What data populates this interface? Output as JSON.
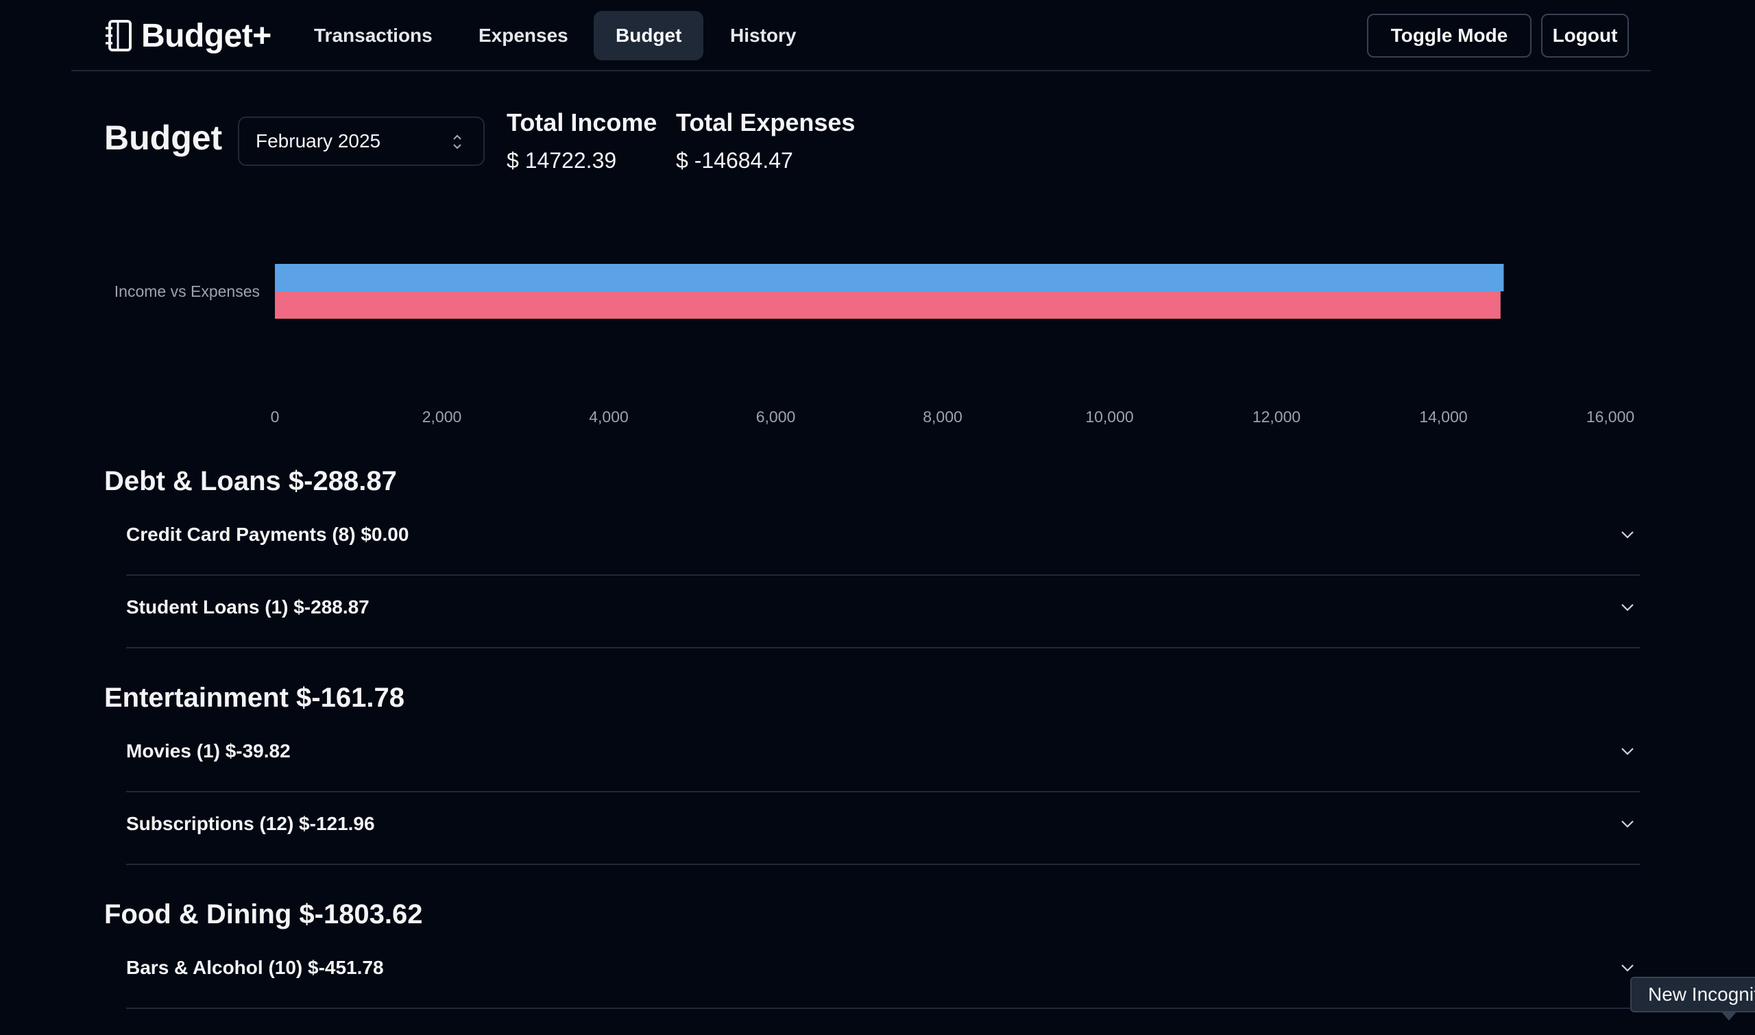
{
  "app": {
    "brand": "Budget+",
    "brand_icon": "notebook-icon"
  },
  "nav": {
    "links": [
      "Transactions",
      "Expenses",
      "Budget",
      "History"
    ],
    "active": "Budget",
    "toggle_mode": "Toggle Mode",
    "logout": "Logout"
  },
  "header": {
    "title": "Budget",
    "month": "February 2025",
    "total_income_label": "Total Income",
    "total_income_value": "$ 14722.39",
    "total_expenses_label": "Total Expenses",
    "total_expenses_value": "$ -14684.47"
  },
  "chart_data": {
    "type": "bar",
    "orientation": "horizontal",
    "categories": [
      "Income vs Expenses"
    ],
    "series": [
      {
        "values": [
          14722.39
        ],
        "color": "#5ba3e6"
      },
      {
        "values": [
          14684.47
        ],
        "color": "#ef6a82"
      }
    ],
    "xlim": [
      0,
      16000
    ],
    "xticks": [
      "0",
      "2,000",
      "4,000",
      "6,000",
      "8,000",
      "10,000",
      "12,000",
      "14,000",
      "16,000"
    ],
    "grid": false
  },
  "categories": [
    {
      "title": "Debt & Loans $-288.87",
      "items": [
        "Credit Card Payments (8) $0.00",
        "Student Loans (1) $-288.87"
      ]
    },
    {
      "title": "Entertainment $-161.78",
      "items": [
        "Movies (1) $-39.82",
        "Subscriptions (12) $-121.96"
      ]
    },
    {
      "title": "Food & Dining $-1803.62",
      "items": [
        "Bars & Alcohol (10) $-451.78"
      ]
    }
  ],
  "tooltip": {
    "text": "New Incognito"
  },
  "colors": {
    "background": "#030712",
    "income": "#5ba3e6",
    "expenses": "#ef6a82",
    "border": "#1f2937"
  }
}
